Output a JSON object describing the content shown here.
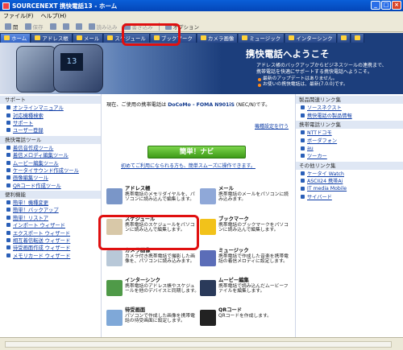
{
  "window": {
    "title": "SOURCENEXT 携快電話13 - ホーム"
  },
  "menubar": {
    "items": [
      "ファイル(F)",
      "ヘルプ(H)"
    ]
  },
  "toolbar": {
    "items": [
      {
        "label": "開",
        "disabled": false
      },
      {
        "label": "保存",
        "disabled": true
      },
      {
        "label": "",
        "disabled": true
      },
      {
        "label": "",
        "disabled": true
      },
      {
        "label": "",
        "disabled": true
      },
      {
        "label": "読み込み",
        "disabled": true
      },
      {
        "label": "書き込み",
        "disabled": true
      },
      {
        "label": "オプション",
        "disabled": false
      }
    ]
  },
  "navtabs": [
    "ホーム",
    "アドレス帳",
    "メール",
    "スケジュール",
    "ブックマーク",
    "カメラ画像",
    "ミュージック",
    "インターシンク"
  ],
  "hero": {
    "phone_screen": "13",
    "welcome": "携快電話へようこそ",
    "desc_lines": [
      "アドレス帳のバックアップからビジネスツールの連携まで、",
      "携帯電話を快適にサポートする携快電話へようこそ。"
    ],
    "news": [
      "最新のアップデートはありません。",
      "お使いの携快電話は、最新(7.0.0)です。"
    ]
  },
  "left": {
    "sections": [
      {
        "title": "サポート",
        "items": [
          "オンラインマニュアル",
          "対応機種検索",
          "サポート",
          "ユーザー登録"
        ]
      },
      {
        "title": "携快電話ツール",
        "items": [
          "着信音作成ツール",
          "着信メロディ編集ツール",
          "ムービー編集ツール",
          "ケータイサウンド作成ツール",
          "画像編集ツール",
          "QRコード作成ツール"
        ]
      },
      {
        "title": "便利機能",
        "items": [
          "簡単！機種変更",
          "簡単！バックアップ",
          "簡単！リストア",
          "インポート ウィザード",
          "エクスポート ウィザード",
          "相互着信転送 ウィザード",
          "待受画面作成 ウィザード",
          "メモリカード ウィザード"
        ]
      }
    ]
  },
  "center": {
    "current_phone_prefix": "現在、ご使用の携帯電話は",
    "current_phone_model": "DoCoMo - FOMA N901iS",
    "current_phone_suffix": "(NEC/N)です。",
    "settings_link": "機種設定を行う",
    "navi_button": "簡単！ナビ",
    "navi_note": "初めてご利用になられる方も、簡単スムーズに操作できます。",
    "functions": [
      {
        "title": "アドレス帳",
        "desc": "携帯電話のメモリダイヤルを、パソコンに読み込んで編集します。",
        "color": "#7a96c8"
      },
      {
        "title": "メール",
        "desc": "携帯電話のメールをパソコンに読み込みます。",
        "color": "#8fa8d8"
      },
      {
        "title": "スケジュール",
        "desc": "携帯電話のスケジュールをパソコンに読み込んで編集します。",
        "color": "#d8c8a8"
      },
      {
        "title": "ブックマーク",
        "desc": "携帯電話のブックマークをパソコンに読み込んで編集します。",
        "color": "#f2c21a"
      },
      {
        "title": "カメラ画像",
        "desc": "カメラ付き携帯電話で撮影した画像を、パソコンに読み込みます。",
        "color": "#b8c8d8"
      },
      {
        "title": "ミュージック",
        "desc": "携帯電話で作成した音楽を携帯電話の着信メロディに設定します。",
        "color": "#5b6db8"
      },
      {
        "title": "インターシンク",
        "desc": "携帯電話のアドレス帳やスケジュールを他のデバイスと同期します。",
        "color": "#4f9a48"
      },
      {
        "title": "ムービー編集",
        "desc": "携帯電話で読み込んだムービーファイルを編集します。",
        "color": "#2a3a5a"
      },
      {
        "title": "待受画面",
        "desc": "パソコンで作成した画像を携帯電話の待受画面に設定します。",
        "color": "#7fa8d8"
      },
      {
        "title": "QRコード",
        "desc": "QRコードを作成します。",
        "color": "#222222"
      }
    ]
  },
  "right": {
    "sections": [
      {
        "title": "製品関連リンク集",
        "items": [
          "ソースネクスト",
          "携快電話の製品情報"
        ]
      },
      {
        "title": "携帯電話リンク集",
        "items": [
          "NTTドコモ",
          "ボーダフォン",
          "au",
          "ツーカー"
        ]
      },
      {
        "title": "その他リンク集",
        "items": [
          "ケータイ Watch",
          "ASCII24 携帯Ai",
          "IT media Mobile",
          "サイバード"
        ]
      }
    ]
  },
  "accent": {
    "highlight": "#e01010",
    "nav": "#1c3e7c",
    "navi_button": "#4caf28"
  }
}
